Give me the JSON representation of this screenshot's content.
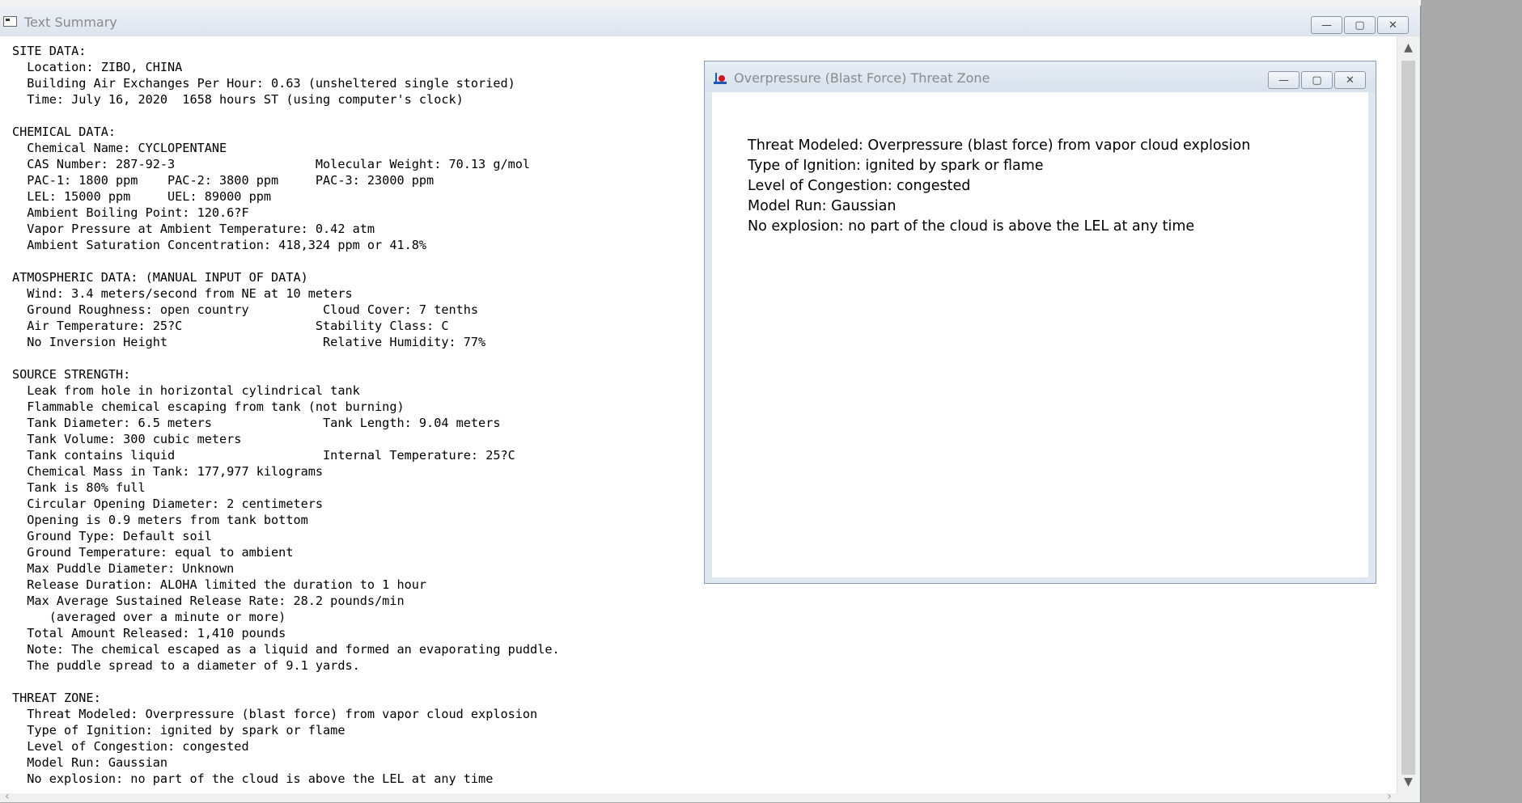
{
  "main_window": {
    "title": "Text Summary",
    "buttons": {
      "minimize": "—",
      "maximize": "▢",
      "close": "✕"
    },
    "summary_lines": [
      "SITE DATA:",
      "  Location: ZIBO, CHINA",
      "  Building Air Exchanges Per Hour: 0.63 (unsheltered single storied)",
      "  Time: July 16, 2020  1658 hours ST (using computer's clock)",
      "",
      "CHEMICAL DATA:",
      "  Chemical Name: CYCLOPENTANE",
      "  CAS Number: 287-92-3                   Molecular Weight: 70.13 g/mol",
      "  PAC-1: 1800 ppm    PAC-2: 3800 ppm     PAC-3: 23000 ppm",
      "  LEL: 15000 ppm     UEL: 89000 ppm",
      "  Ambient Boiling Point: 120.6?F",
      "  Vapor Pressure at Ambient Temperature: 0.42 atm",
      "  Ambient Saturation Concentration: 418,324 ppm or 41.8%",
      "",
      "ATMOSPHERIC DATA: (MANUAL INPUT OF DATA)",
      "  Wind: 3.4 meters/second from NE at 10 meters",
      "  Ground Roughness: open country          Cloud Cover: 7 tenths",
      "  Air Temperature: 25?C                  Stability Class: C",
      "  No Inversion Height                     Relative Humidity: 77%",
      "",
      "SOURCE STRENGTH:",
      "  Leak from hole in horizontal cylindrical tank",
      "  Flammable chemical escaping from tank (not burning)",
      "  Tank Diameter: 6.5 meters               Tank Length: 9.04 meters",
      "  Tank Volume: 300 cubic meters",
      "  Tank contains liquid                    Internal Temperature: 25?C",
      "  Chemical Mass in Tank: 177,977 kilograms",
      "  Tank is 80% full",
      "  Circular Opening Diameter: 2 centimeters",
      "  Opening is 0.9 meters from tank bottom",
      "  Ground Type: Default soil",
      "  Ground Temperature: equal to ambient",
      "  Max Puddle Diameter: Unknown",
      "  Release Duration: ALOHA limited the duration to 1 hour",
      "  Max Average Sustained Release Rate: 28.2 pounds/min",
      "     (averaged over a minute or more)",
      "  Total Amount Released: 1,410 pounds",
      "  Note: The chemical escaped as a liquid and formed an evaporating puddle.",
      "  The puddle spread to a diameter of 9.1 yards.",
      "",
      "THREAT ZONE:",
      "  Threat Modeled: Overpressure (blast force) from vapor cloud explosion",
      "  Type of Ignition: ignited by spark or flame",
      "  Level of Congestion: congested",
      "  Model Run: Gaussian",
      "  No explosion: no part of the cloud is above the LEL at any time"
    ]
  },
  "threat_window": {
    "title": "Overpressure (Blast Force) Threat Zone",
    "buttons": {
      "minimize": "—",
      "maximize": "▢",
      "close": "✕"
    },
    "lines": [
      "Threat Modeled: Overpressure (blast force) from vapor cloud explosion",
      "Type of Ignition: ignited by spark or flame",
      "Level of Congestion: congested",
      "Model Run: Gaussian",
      "No explosion: no part of the cloud is above the LEL at any time"
    ]
  },
  "scrollbar": {
    "up_arrow": "▲",
    "down_arrow": "▼",
    "left_arrow": "‹",
    "right_arrow": "›"
  },
  "colors": {
    "title_text": "#8a8a8a",
    "threat_icon_red": "#d4141e",
    "threat_icon_blue": "#1a56b5"
  }
}
